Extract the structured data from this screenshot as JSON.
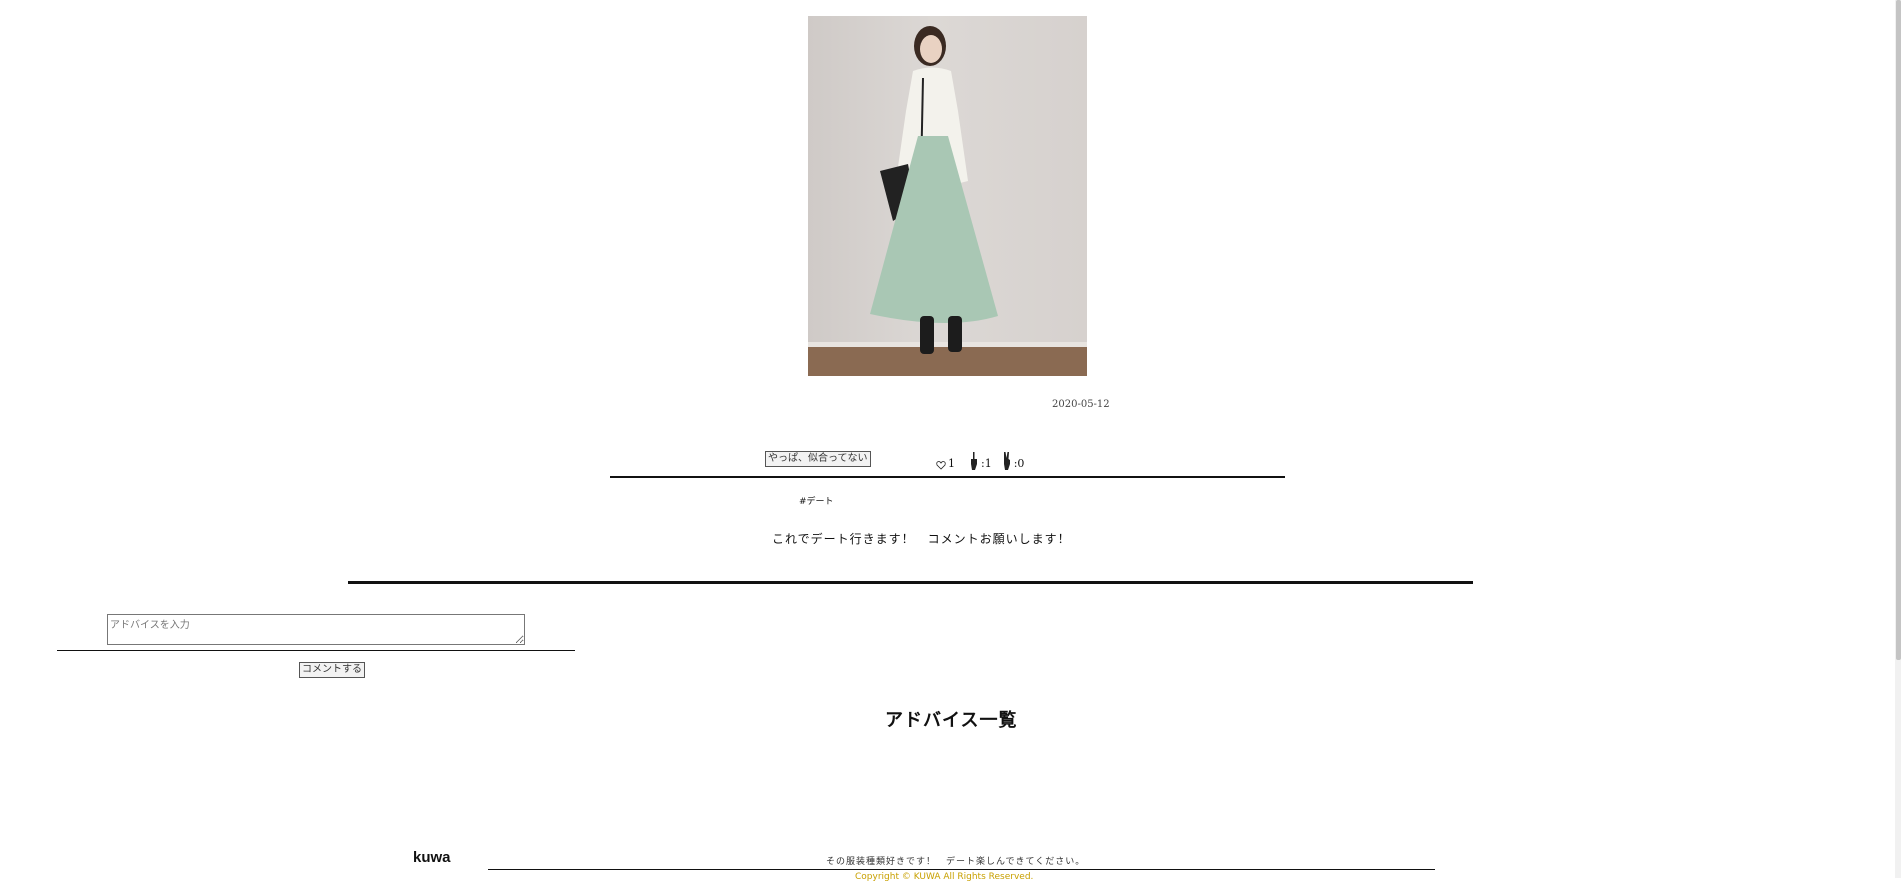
{
  "post": {
    "date": "2020-05-12",
    "vote_button_label": "やっぱ、似合ってない",
    "likes": "1",
    "good_count": ":1",
    "bad_count": ":0",
    "tag": "#デート",
    "caption": "これでデート行きます！　コメントお願いします！"
  },
  "advice_form": {
    "placeholder": "アドバイスを入力",
    "submit_label": "コメントする"
  },
  "advice_list": {
    "title": "アドバイス一覧",
    "items": [
      {
        "user": "kuwa",
        "text": "その服装種類好きです！　デート楽しんできてください。"
      }
    ]
  },
  "footer": {
    "copyright": "Copyright © KUWA All Rights Reserved."
  },
  "icons": {
    "heart": "heart-icon",
    "good": "hand-up-icon",
    "bad": "hand-peace-icon"
  },
  "colors": {
    "text": "#222222",
    "rule": "#111111",
    "copyright": "#c8a000"
  }
}
